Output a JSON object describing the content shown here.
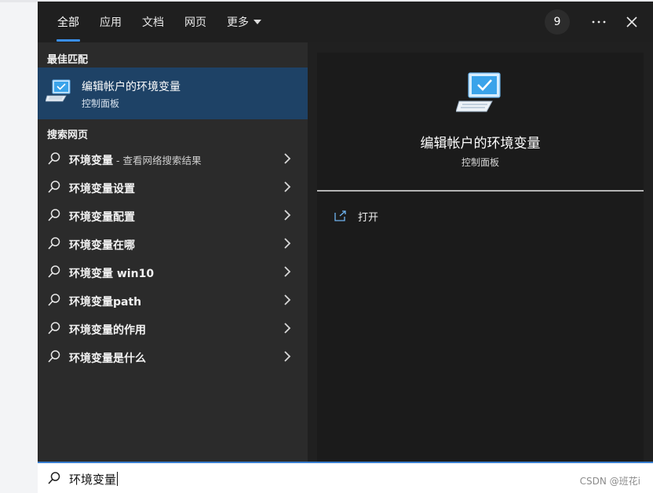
{
  "tabs": [
    {
      "label": "全部",
      "active": true
    },
    {
      "label": "应用",
      "active": false
    },
    {
      "label": "文档",
      "active": false
    },
    {
      "label": "网页",
      "active": false
    },
    {
      "label": "更多",
      "active": false,
      "has_dropdown": true
    }
  ],
  "header": {
    "badge_count": "9",
    "more_icon": "more-icon",
    "close_icon": "close-icon"
  },
  "best_match": {
    "section_title": "最佳匹配",
    "title": "编辑帐户的环境变量",
    "subtitle": "控制面板",
    "icon": "control-panel-monitor-icon"
  },
  "web_search": {
    "section_title": "搜索网页",
    "items": [
      {
        "label": "环境变量",
        "suffix": " - 查看网络搜索结果"
      },
      {
        "label": "环境变量设置",
        "suffix": ""
      },
      {
        "label": "环境变量配置",
        "suffix": ""
      },
      {
        "label": "环境变量在哪",
        "suffix": ""
      },
      {
        "label": "环境变量 win10",
        "suffix": ""
      },
      {
        "label": "环境变量path",
        "suffix": ""
      },
      {
        "label": "环境变量的作用",
        "suffix": ""
      },
      {
        "label": "环境变量是什么",
        "suffix": ""
      }
    ]
  },
  "detail": {
    "title": "编辑帐户的环境变量",
    "subtitle": "控制面板",
    "actions": [
      {
        "label": "打开",
        "icon": "open-icon"
      }
    ]
  },
  "search": {
    "value": "环境变量"
  },
  "watermark": "CSDN @班花i",
  "colors": {
    "accent": "#3a8eea",
    "selected_row": "#1e4266",
    "panel_bg": "#202020",
    "left_bg": "#2b2b2b",
    "right_bg": "#1b1b1b"
  }
}
